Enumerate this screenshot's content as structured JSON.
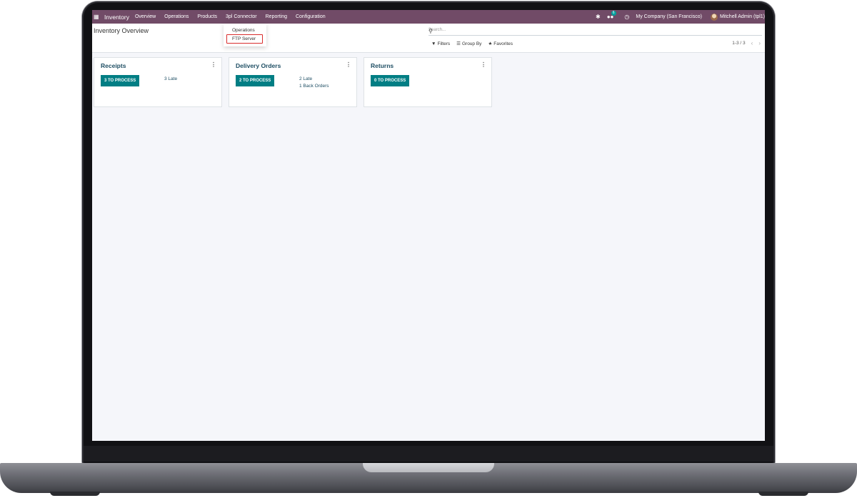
{
  "navbar": {
    "app_name": "Inventory",
    "menu": [
      "Overview",
      "Operations",
      "Products",
      "3pl Connector",
      "Reporting",
      "Configuration"
    ],
    "company": "My Company (San Francisco)",
    "user": "Mitchell Admin (tpl1)",
    "messages_badge": "6",
    "icons": [
      "apps-grid-icon",
      "bug-icon",
      "chat-icon",
      "clock-icon"
    ]
  },
  "dropdown": {
    "items": [
      "Operations",
      "FTP Server"
    ],
    "highlighted": "FTP Server"
  },
  "control_panel": {
    "title": "Inventory Overview",
    "search_placeholder": "Search...",
    "filters_label": "Filters",
    "group_by_label": "Group By",
    "favorites_label": "Favorites",
    "pager": "1-3 / 3"
  },
  "cards": [
    {
      "title": "Receipts",
      "button": "3 TO PROCESS",
      "stats": [
        "3 Late"
      ]
    },
    {
      "title": "Delivery Orders",
      "button": "2 TO PROCESS",
      "stats": [
        "2 Late",
        "1 Back Orders"
      ]
    },
    {
      "title": "Returns",
      "button": "0 TO PROCESS",
      "stats": []
    }
  ],
  "colors": {
    "navbar": "#714b67",
    "accent": "#017e84",
    "highlight_box": "#d92c2c"
  }
}
